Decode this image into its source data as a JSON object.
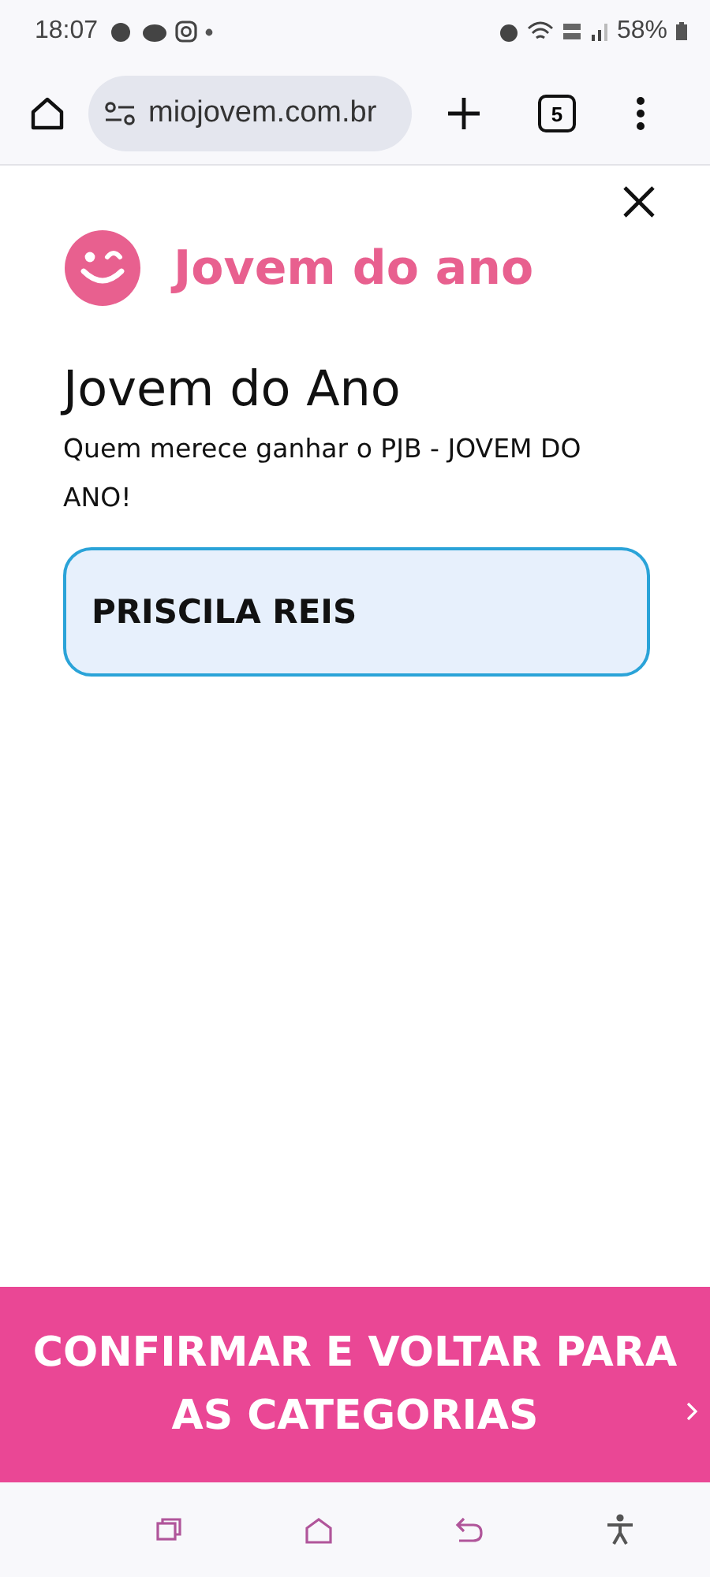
{
  "status_bar": {
    "time": "18:07",
    "battery": "58%"
  },
  "browser": {
    "url": "miojovem.com.br",
    "tab_count": "5"
  },
  "brand": {
    "name": "Jovem do ano"
  },
  "title": "Jovem do Ano",
  "question": "Quem merece ganhar o PJB - JOVEM DO ANO!",
  "options": [
    {
      "label": "PRISCILA REIS",
      "selected": true
    }
  ],
  "confirm_button": "CONFIRMAR E VOLTAR PARA AS CATEGORIAS"
}
